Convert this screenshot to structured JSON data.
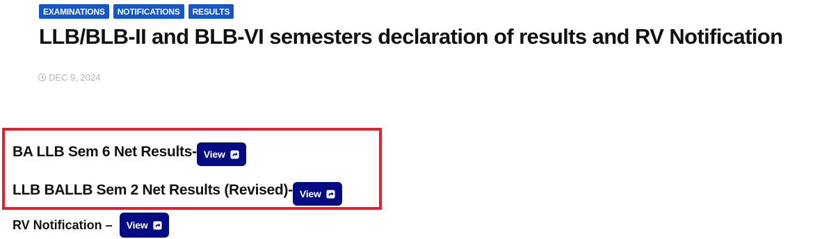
{
  "tags": [
    "EXAMINATIONS",
    "NOTIFICATIONS",
    "RESULTS"
  ],
  "post": {
    "title": "LLB/BLB-II and BLB-VI semesters declaration of results and RV Notification",
    "date": "DEC 9, 2024"
  },
  "results": [
    {
      "label": "BA LLB Sem 6 Net Results-",
      "button": "View"
    },
    {
      "label": "LLB BALLB Sem 2 Net Results (Revised)-",
      "button": "View"
    },
    {
      "label": "RV Notification –",
      "button": "View"
    }
  ],
  "colors": {
    "tag_bg": "#1556c9",
    "button_bg": "#040c84",
    "highlight_border": "#e5202c",
    "date_text": "#b5b5b5"
  },
  "icons": {
    "date": "clock-icon",
    "view_button": "share-icon"
  }
}
